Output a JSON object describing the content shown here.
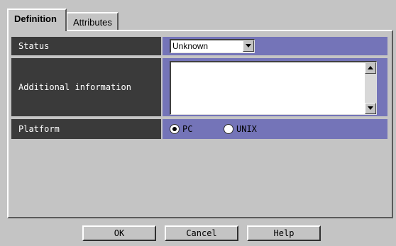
{
  "tabs": [
    {
      "label": "Definition",
      "active": true
    },
    {
      "label": "Attributes",
      "active": false
    }
  ],
  "fields": {
    "status": {
      "label": "Status",
      "value": "Unknown"
    },
    "additional_information": {
      "label": "Additional information",
      "value": ""
    },
    "platform": {
      "label": "Platform",
      "options": [
        {
          "label": "PC",
          "checked": true
        },
        {
          "label": "UNIX",
          "checked": false
        }
      ]
    }
  },
  "buttons": {
    "ok": "OK",
    "cancel": "Cancel",
    "help": "Help"
  },
  "colors": {
    "label_bg": "#3a3a3a",
    "value_bg": "#7474b8",
    "window_bg": "#c4c4c4"
  },
  "icons": {
    "status_dropdown": "chevron-down-icon",
    "scroll_up": "arrow-up-icon",
    "scroll_down": "arrow-down-icon"
  }
}
